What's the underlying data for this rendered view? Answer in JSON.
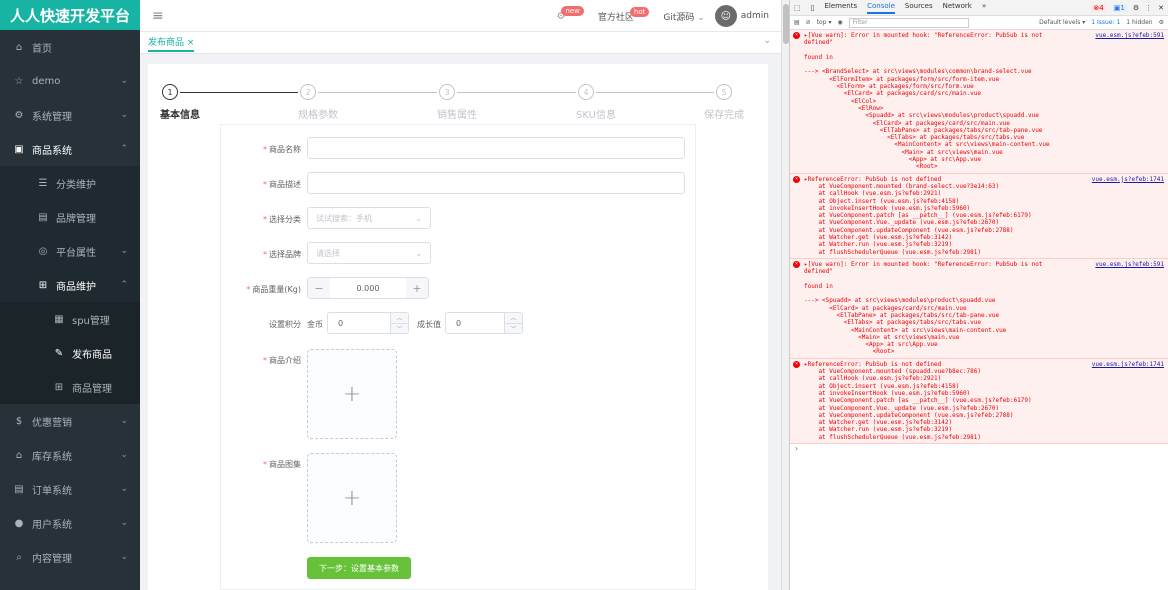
{
  "sidebar": {
    "brand": "人人快速开发平台",
    "items": [
      {
        "label": "首页",
        "icon": "home-icon",
        "glyph": "⌂",
        "arrow": "",
        "level": 0
      },
      {
        "label": "demo",
        "icon": "star-icon",
        "glyph": "☆",
        "arrow": "⌄",
        "level": 0
      },
      {
        "label": "系统管理",
        "icon": "gear-icon",
        "glyph": "⚙",
        "arrow": "⌄",
        "level": 0
      },
      {
        "label": "商品系统",
        "icon": "box-icon",
        "glyph": "▣",
        "arrow": "⌃",
        "level": 0,
        "open": true
      },
      {
        "label": "分类维护",
        "icon": "list-icon",
        "glyph": "☰",
        "arrow": "",
        "level": 1
      },
      {
        "label": "品牌管理",
        "icon": "tag-icon",
        "glyph": "▤",
        "arrow": "",
        "level": 1
      },
      {
        "label": "平台属性",
        "icon": "target-icon",
        "glyph": "◎",
        "arrow": "⌄",
        "level": 1
      },
      {
        "label": "商品维护",
        "icon": "grid-icon",
        "glyph": "⊞",
        "arrow": "⌃",
        "level": 1,
        "open": true
      },
      {
        "label": "spu管理",
        "icon": "doc-icon",
        "glyph": "▦",
        "arrow": "",
        "level": 2
      },
      {
        "label": "发布商品",
        "icon": "edit-icon",
        "glyph": "✎",
        "arrow": "",
        "level": 2,
        "active": true
      },
      {
        "label": "商品管理",
        "icon": "grid-icon",
        "glyph": "⊞",
        "arrow": "",
        "level": 2
      },
      {
        "label": "优惠营销",
        "icon": "coin-icon",
        "glyph": "$",
        "arrow": "⌄",
        "level": 0
      },
      {
        "label": "库存系统",
        "icon": "home-icon",
        "glyph": "⌂",
        "arrow": "⌄",
        "level": 0
      },
      {
        "label": "订单系统",
        "icon": "order-icon",
        "glyph": "▤",
        "arrow": "⌄",
        "level": 0
      },
      {
        "label": "用户系统",
        "icon": "user-icon",
        "glyph": "●",
        "arrow": "⌄",
        "level": 0
      },
      {
        "label": "内容管理",
        "icon": "search-icon",
        "glyph": "⌕",
        "arrow": "⌄",
        "level": 0
      }
    ]
  },
  "topbar": {
    "badge_new": "new",
    "community": "官方社区",
    "badge_hot": "hot",
    "git": "Git源码",
    "user": "admin"
  },
  "tabs": {
    "active": "发布商品 ×"
  },
  "steps": [
    {
      "num": "1",
      "label": "基本信息",
      "active": true
    },
    {
      "num": "2",
      "label": "规格参数"
    },
    {
      "num": "3",
      "label": "销售属性"
    },
    {
      "num": "4",
      "label": "SKU信息"
    },
    {
      "num": "5",
      "label": "保存完成"
    }
  ],
  "form": {
    "name_label": "商品名称",
    "desc_label": "商品描述",
    "category_label": "选择分类",
    "category_placeholder": "试试搜索：手机",
    "brand_label": "选择品牌",
    "brand_placeholder": "请选择",
    "weight_label": "商品重量(Kg)",
    "weight_value": "0.000",
    "points_label": "设置积分",
    "gold_label": "金币",
    "gold_value": "0",
    "growth_label": "成长值",
    "growth_value": "0",
    "intro_label": "商品介绍",
    "images_label": "商品图集",
    "next_button": "下一步：设置基本参数"
  },
  "devtools": {
    "tabs": [
      "Elements",
      "Console",
      "Sources",
      "Network",
      "»"
    ],
    "error_count": "4",
    "msg_count": "1",
    "context": "top ▾",
    "filter_placeholder": "Filter",
    "levels": "Default levels ▾",
    "issue": "1 Issue: 1",
    "hidden": "1 hidden",
    "entries": [
      {
        "src": "vue.esm.js?efeb:591",
        "lines": [
          "▸[Vue warn]: Error in mounted hook: \"ReferenceError: PubSub is not",
          "defined\"",
          "",
          "found in",
          "",
          "---> <BrandSelect> at src\\views\\modules\\common\\brand-select.vue",
          "       <ElFormItem> at packages/form/src/form-item.vue",
          "         <ElForm> at packages/form/src/form.vue",
          "           <ElCard> at packages/card/src/main.vue",
          "             <ElCol>",
          "               <ElRow>",
          "                 <Spuadd> at src\\views\\modules\\product\\spuadd.vue",
          "                   <ElCard> at packages/card/src/main.vue",
          "                     <ElTabPane> at packages/tabs/src/tab-pane.vue",
          "                       <ElTabs> at packages/tabs/src/tabs.vue",
          "                         <MainContent> at src\\views\\main-content.vue",
          "                           <Main> at src\\views\\main.vue",
          "                             <App> at src\\App.vue",
          "                               <Root>"
        ]
      },
      {
        "src": "vue.esm.js?efeb:1741",
        "lines": [
          "▸ReferenceError: PubSub is not defined",
          "    at VueComponent.mounted (brand-select.vue?3e14:63)",
          "    at callHook (vue.esm.js?efeb:2921)",
          "    at Object.insert (vue.esm.js?efeb:4158)",
          "    at invokeInsertHook (vue.esm.js?efeb:5960)",
          "    at VueComponent.patch [as __patch__] (vue.esm.js?efeb:6179)",
          "    at VueComponent.Vue._update (vue.esm.js?efeb:2670)",
          "    at VueComponent.updateComponent (vue.esm.js?efeb:2788)",
          "    at Watcher.get (vue.esm.js?efeb:3142)",
          "    at Watcher.run (vue.esm.js?efeb:3219)",
          "    at flushSchedulerQueue (vue.esm.js?efeb:2981)"
        ]
      },
      {
        "src": "vue.esm.js?efeb:591",
        "lines": [
          "▸[Vue warn]: Error in mounted hook: \"ReferenceError: PubSub is not",
          "defined\"",
          "",
          "found in",
          "",
          "---> <Spuadd> at src\\views\\modules\\product\\spuadd.vue",
          "       <ElCard> at packages/card/src/main.vue",
          "         <ElTabPane> at packages/tabs/src/tab-pane.vue",
          "           <ElTabs> at packages/tabs/src/tabs.vue",
          "             <MainContent> at src\\views\\main-content.vue",
          "               <Main> at src\\views\\main.vue",
          "                 <App> at src\\App.vue",
          "                   <Root>"
        ]
      },
      {
        "src": "vue.esm.js?efeb:1741",
        "lines": [
          "▸ReferenceError: PubSub is not defined",
          "    at VueComponent.mounted (spuadd.vue?b8ec:786)",
          "    at callHook (vue.esm.js?efeb:2921)",
          "    at Object.insert (vue.esm.js?efeb:4158)",
          "    at invokeInsertHook (vue.esm.js?efeb:5960)",
          "    at VueComponent.patch [as __patch__] (vue.esm.js?efeb:6179)",
          "    at VueComponent.Vue._update (vue.esm.js?efeb:2670)",
          "    at VueComponent.updateComponent (vue.esm.js?efeb:2788)",
          "    at Watcher.get (vue.esm.js?efeb:3142)",
          "    at Watcher.run (vue.esm.js?efeb:3219)",
          "    at flushSchedulerQueue (vue.esm.js?efeb:2981)"
        ]
      }
    ],
    "prompt": "›"
  },
  "colors": {
    "brand": "#17b3a3",
    "sidebar": "#263238",
    "success": "#67c23a",
    "error": "#e00000"
  }
}
